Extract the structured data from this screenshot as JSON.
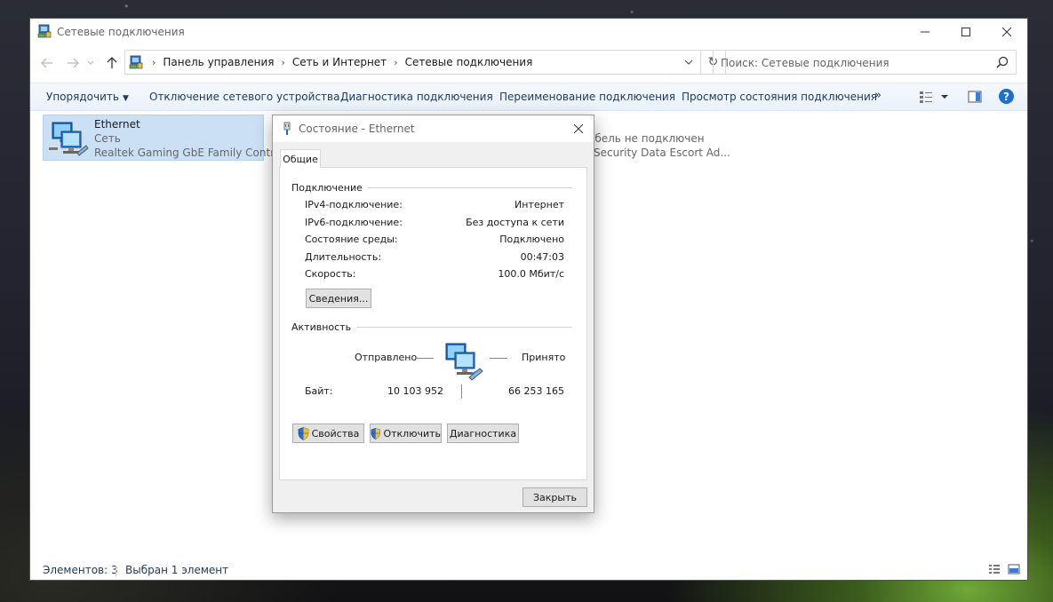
{
  "window": {
    "title": "Сетевые подключения",
    "controls": {
      "minimize": "—",
      "maximize": "☐",
      "close": "✕"
    }
  },
  "address": {
    "breadcrumbs": [
      "Панель управления",
      "Сеть и Интернет",
      "Сетевые подключения"
    ],
    "search_placeholder": "Поиск: Сетевые подключения"
  },
  "toolbar": {
    "organize": "Упорядочить",
    "disable": "Отключение сетевого устройства",
    "diagnose": "Диагностика подключения",
    "rename": "Переименование подключения",
    "view_status": "Просмотр состояния подключения",
    "more": "»"
  },
  "items": [
    {
      "name": "Ethernet",
      "line2": "Сеть",
      "line3": "Realtek Gaming GbE Family Contr..."
    },
    {
      "line2_partial": "абель не подключен",
      "line3_partial": "Security Data Escort Ad..."
    }
  ],
  "status": {
    "count": "Элементов: 3",
    "selected": "Выбран 1 элемент"
  },
  "dialog": {
    "title": "Состояние - Ethernet",
    "tab": "Общие",
    "connection_header": "Подключение",
    "rows": [
      {
        "key": "IPv4-подключение:",
        "value": "Интернет"
      },
      {
        "key": "IPv6-подключение:",
        "value": "Без доступа к сети"
      },
      {
        "key": "Состояние среды:",
        "value": "Подключено"
      },
      {
        "key": "Длительность:",
        "value": "00:47:03"
      },
      {
        "key": "Скорость:",
        "value": "100.0 Мбит/с"
      }
    ],
    "details_button": "Сведения...",
    "activity_header": "Активность",
    "sent_label": "Отправлено",
    "received_label": "Принято",
    "bytes_label": "Байт:",
    "bytes_sent": "10 103 952",
    "bytes_received": "66 253 165",
    "properties_button": "Свойства",
    "disable_button": "Отключить",
    "diagnose_button": "Диагностика",
    "close_button": "Закрыть"
  },
  "colors": {
    "accent": "#1c6fd1",
    "selection": "#cce0f5",
    "command_text": "#1e395b"
  }
}
